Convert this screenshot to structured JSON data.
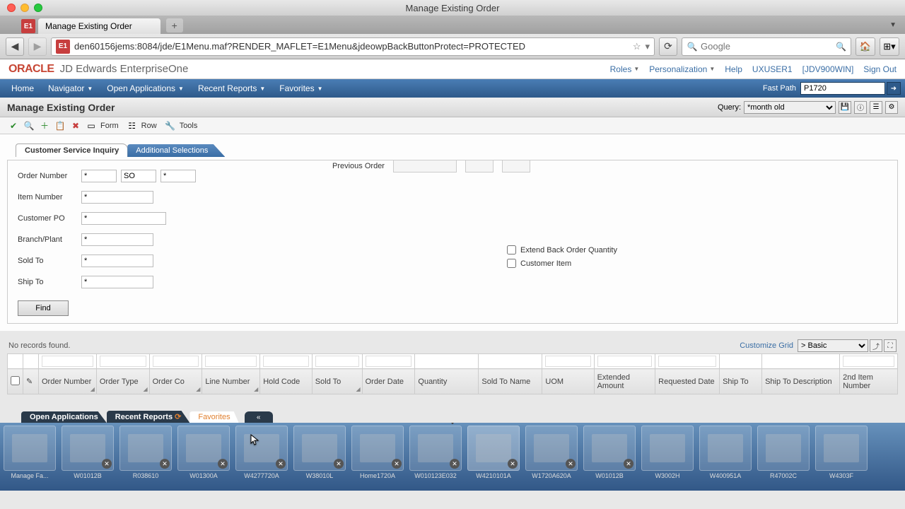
{
  "window_title": "Manage Existing Order",
  "browser_tab_title": "Manage Existing Order",
  "url": "den60156jems:8084/jde/E1Menu.maf?RENDER_MAFLET=E1Menu&jdeowpBackButtonProtect=PROTECTED",
  "search_placeholder": "Google",
  "oracle": {
    "logo": "ORACLE",
    "product": "JD Edwards EnterpriseOne"
  },
  "header_links": {
    "roles": "Roles",
    "personalization": "Personalization",
    "help": "Help",
    "user": "UXUSER1",
    "env": "[JDV900WIN]",
    "signout": "Sign Out"
  },
  "menu": {
    "home": "Home",
    "navigator": "Navigator",
    "open_apps": "Open Applications",
    "recent_reports": "Recent Reports",
    "favorites": "Favorites",
    "fastpath_label": "Fast Path",
    "fastpath_value": "P1720"
  },
  "form": {
    "title": "Manage Existing Order",
    "query_label": "Query:",
    "query_value": "*month old",
    "toolbar": {
      "form": "Form",
      "row": "Row",
      "tools": "Tools"
    },
    "tabs": {
      "t1": "Customer Service Inquiry",
      "t2": "Additional Selections"
    },
    "labels": {
      "order_number": "Order Number",
      "item_number": "Item Number",
      "customer_po": "Customer PO",
      "branch_plant": "Branch/Plant",
      "sold_to": "Sold To",
      "ship_to": "Ship To",
      "previous_order": "Previous Order",
      "extend_back": "Extend Back Order Quantity",
      "customer_item": "Customer Item"
    },
    "values": {
      "order_number": "*",
      "order_type": "SO",
      "order_co": "*",
      "item_number": "*",
      "customer_po": "*",
      "branch_plant": "*",
      "sold_to": "*",
      "ship_to": "*"
    },
    "find_btn": "Find"
  },
  "grid": {
    "no_records": "No records found.",
    "customize": "Customize Grid",
    "basic": "> Basic",
    "columns": {
      "order_number": "Order Number",
      "order_type": "Order Type",
      "order_co": "Order Co",
      "line_number": "Line Number",
      "hold_code": "Hold Code",
      "sold_to": "Sold To",
      "order_date": "Order Date",
      "quantity": "Quantity",
      "sold_to_name": "Sold To Name",
      "uom": "UOM",
      "extended_amount": "Extended Amount",
      "requested_date": "Requested Date",
      "ship_to": "Ship To",
      "ship_to_desc": "Ship To Description",
      "second_item": "2nd Item Number"
    }
  },
  "bottom_tabs": {
    "open_apps": "Open Applications",
    "recent_reports": "Recent Reports",
    "favorites": "Favorites"
  },
  "carousel": [
    {
      "label": "Manage Fa..."
    },
    {
      "label": "W01012B"
    },
    {
      "label": "R038610"
    },
    {
      "label": "W01300A"
    },
    {
      "label": "W4277720A"
    },
    {
      "label": "W38010L"
    },
    {
      "label": "Home1720A"
    },
    {
      "label": "W010123E032"
    },
    {
      "label": "W4210101A"
    },
    {
      "label": "W1720A620A"
    },
    {
      "label": "W01012B"
    },
    {
      "label": "W3002H"
    },
    {
      "label": "W400951A"
    },
    {
      "label": "R47002C"
    },
    {
      "label": "W4303F"
    }
  ]
}
